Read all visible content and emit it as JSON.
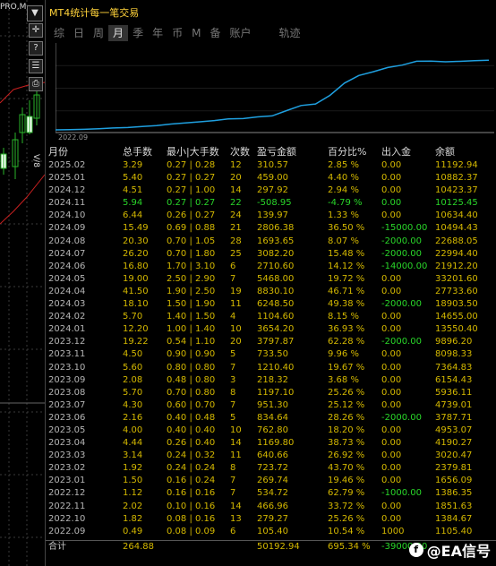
{
  "background": {
    "top_label": "PRO,M"
  },
  "toolbar": {
    "arrow_glyph": "▼",
    "crosshair_glyph": "✛",
    "help_glyph": "?",
    "tool2_glyph": "☰",
    "tool3_glyph": "⎙"
  },
  "panel": {
    "title": "MT4统计每一笔交易",
    "tabs": [
      {
        "label": "综"
      },
      {
        "label": "日"
      },
      {
        "label": "周"
      },
      {
        "label": "月"
      },
      {
        "label": "季"
      },
      {
        "label": "年"
      },
      {
        "label": "币"
      },
      {
        "label": "M"
      },
      {
        "label": "备"
      },
      {
        "label": "账户"
      },
      {
        "label": "轨迹"
      }
    ],
    "active_tab": "月",
    "chart_start_label": "2022.09",
    "chart_line_color": "#1fa0e0",
    "headers": [
      "月份",
      "总手数",
      "最小|大手数",
      "次数",
      "盈亏金额",
      "百分比%",
      "出入金",
      "余额"
    ],
    "rows": [
      [
        "2025.02",
        "3.29",
        "0.27 | 0.28",
        "12",
        "310.57",
        "2.85 %",
        "0.00",
        "11192.94"
      ],
      [
        "2025.01",
        "5.40",
        "0.27 | 0.27",
        "20",
        "459.00",
        "4.40 %",
        "0.00",
        "10882.37"
      ],
      [
        "2024.12",
        "4.51",
        "0.27 | 1.00",
        "14",
        "297.92",
        "2.94 %",
        "0.00",
        "10423.37"
      ],
      [
        "2024.11",
        "5.94",
        "0.27 | 0.27",
        "22",
        "-508.95",
        "-4.79 %",
        "0.00",
        "10125.45"
      ],
      [
        "2024.10",
        "6.44",
        "0.26 | 0.27",
        "24",
        "139.97",
        "1.33 %",
        "0.00",
        "10634.40"
      ],
      [
        "2024.09",
        "15.49",
        "0.69 | 0.88",
        "21",
        "2806.38",
        "36.50 %",
        "-15000.00",
        "10494.43"
      ],
      [
        "2024.08",
        "20.30",
        "0.70 | 1.05",
        "28",
        "1693.65",
        "8.07 %",
        "-2000.00",
        "22688.05"
      ],
      [
        "2024.07",
        "26.20",
        "0.70 | 1.80",
        "25",
        "3082.20",
        "15.48 %",
        "-2000.00",
        "22994.40"
      ],
      [
        "2024.06",
        "16.80",
        "1.70 | 3.10",
        "6",
        "2710.60",
        "14.12 %",
        "-14000.00",
        "21912.20"
      ],
      [
        "2024.05",
        "19.00",
        "2.50 | 2.90",
        "7",
        "5468.00",
        "19.72 %",
        "0.00",
        "33201.60"
      ],
      [
        "2024.04",
        "41.50",
        "1.90 | 2.50",
        "19",
        "8830.10",
        "46.71 %",
        "0.00",
        "27733.60"
      ],
      [
        "2024.03",
        "18.10",
        "1.50 | 1.90",
        "11",
        "6248.50",
        "49.38 %",
        "-2000.00",
        "18903.50"
      ],
      [
        "2024.02",
        "5.70",
        "1.40 | 1.50",
        "4",
        "1104.60",
        "8.15 %",
        "0.00",
        "14655.00"
      ],
      [
        "2024.01",
        "12.20",
        "1.00 | 1.40",
        "10",
        "3654.20",
        "36.93 %",
        "0.00",
        "13550.40"
      ],
      [
        "2023.12",
        "19.22",
        "0.54 | 1.10",
        "20",
        "3797.87",
        "62.28 %",
        "-2000.00",
        "9896.20"
      ],
      [
        "2023.11",
        "4.50",
        "0.90 | 0.90",
        "5",
        "733.50",
        "9.96 %",
        "0.00",
        "8098.33"
      ],
      [
        "2023.10",
        "5.60",
        "0.80 | 0.80",
        "7",
        "1210.40",
        "19.67 %",
        "0.00",
        "7364.83"
      ],
      [
        "2023.09",
        "2.08",
        "0.48 | 0.80",
        "3",
        "218.32",
        "3.68 %",
        "0.00",
        "6154.43"
      ],
      [
        "2023.08",
        "5.70",
        "0.70 | 0.80",
        "8",
        "1197.10",
        "25.26 %",
        "0.00",
        "5936.11"
      ],
      [
        "2023.07",
        "4.30",
        "0.60 | 0.70",
        "7",
        "951.30",
        "25.12 %",
        "0.00",
        "4739.01"
      ],
      [
        "2023.06",
        "2.16",
        "0.40 | 0.48",
        "5",
        "834.64",
        "28.26 %",
        "-2000.00",
        "3787.71"
      ],
      [
        "2023.05",
        "4.00",
        "0.40 | 0.40",
        "10",
        "762.80",
        "18.20 %",
        "0.00",
        "4953.07"
      ],
      [
        "2023.04",
        "4.44",
        "0.26 | 0.40",
        "14",
        "1169.80",
        "38.73 %",
        "0.00",
        "4190.27"
      ],
      [
        "2023.03",
        "3.14",
        "0.24 | 0.32",
        "11",
        "640.66",
        "26.92 %",
        "0.00",
        "3020.47"
      ],
      [
        "2023.02",
        "1.92",
        "0.24 | 0.24",
        "8",
        "723.72",
        "43.70 %",
        "0.00",
        "2379.81"
      ],
      [
        "2023.01",
        "1.50",
        "0.16 | 0.24",
        "7",
        "269.74",
        "19.46 %",
        "0.00",
        "1656.09"
      ],
      [
        "2022.12",
        "1.12",
        "0.16 | 0.16",
        "7",
        "534.72",
        "62.79 %",
        "-1000.00",
        "1386.35"
      ],
      [
        "2022.11",
        "2.02",
        "0.10 | 0.16",
        "14",
        "466.96",
        "33.72 %",
        "0.00",
        "1851.63"
      ],
      [
        "2022.10",
        "1.82",
        "0.08 | 0.16",
        "13",
        "279.27",
        "25.26 %",
        "0.00",
        "1384.67"
      ],
      [
        "2022.09",
        "0.49",
        "0.08 | 0.09",
        "6",
        "105.40",
        "10.54 %",
        "1000",
        "1105.40"
      ]
    ],
    "total": [
      "合计",
      "264.88",
      "",
      "",
      "50192.94",
      "695.34 %",
      "-39000.00",
      ""
    ]
  },
  "watermark": {
    "icon_letter": "f",
    "text": "@EA信号"
  }
}
